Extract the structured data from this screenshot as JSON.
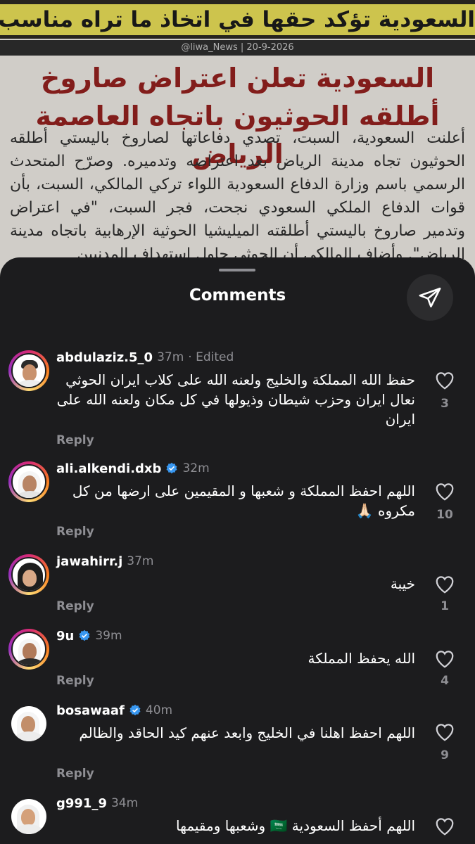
{
  "background_post": {
    "banner_text": "السعودية تؤكد حقها في اتخاذ ما تراه مناسب",
    "credit": "@liwa_News | 20-9-2026",
    "headline": "السعودية تعلن اعتراض صاروخ أطلقه الحوثيون باتجاه العاصمة الرياض",
    "article": "أعلنت السعودية، السبت، تصدي دفاعاتها لصاروخ باليستي أطلقه الحوثيون تجاه مدينة الرياض بعد اعتراضه وتدميره. وصرّح المتحدث الرسمي باسم وزارة الدفاع السعودية اللواء تركي المالكي، السبت، بأن قوات الدفاع الملكي السعودي نجحت، فجر السبت، \"في اعتراض وتدمير صاروخ باليستي أطلقته الميليشيا الحوثية الإرهابية باتجاه مدينة الرياض\". وأضاف المالكي أن الحوثي حاول استهداف المدنيين"
  },
  "sheet": {
    "title": "Comments",
    "share_icon": "send-icon"
  },
  "comments": [
    {
      "username": "abdulaziz.5_0",
      "verified": false,
      "time": "37m",
      "edited": "· Edited",
      "text": "حفظ الله المملكة والخليج ولعنه الله على كلاب ايران الحوثي نعال ايران وحزب شيطان وذيولها في كل مكان ولعنه الله على ايران",
      "reply": "Reply",
      "likes": "3"
    },
    {
      "username": "ali.alkendi.dxb",
      "verified": true,
      "time": "32m",
      "edited": "",
      "text": "اللهم احفظ المملكة و شعبها و المقيمين على ارضها من كل مكروه 🙏🏻",
      "reply": "Reply",
      "likes": "10"
    },
    {
      "username": "jawahirr.j",
      "verified": false,
      "time": "37m",
      "edited": "",
      "text": "خيبة",
      "reply": "Reply",
      "likes": "1"
    },
    {
      "username": "9u",
      "verified": true,
      "time": "39m",
      "edited": "",
      "text": "الله يحفظ المملكة",
      "reply": "Reply",
      "likes": "4"
    },
    {
      "username": "bosawaaf",
      "verified": true,
      "time": "40m",
      "edited": "",
      "text": "اللهم احفظ اهلنا في الخليج وابعد عنهم كيد الحاقد والظالم",
      "reply": "Reply",
      "likes": "9"
    },
    {
      "username": "g991_9",
      "verified": false,
      "time": "34m",
      "edited": "",
      "text": "اللهم أحفظ السعودية 🇸🇦 وشعبها ومقيمها",
      "reply": "",
      "likes": ""
    }
  ],
  "colors": {
    "sheet_bg": "#1c1c1e",
    "verified_blue": "#3897f0",
    "muted_text": "#8e8e93"
  }
}
